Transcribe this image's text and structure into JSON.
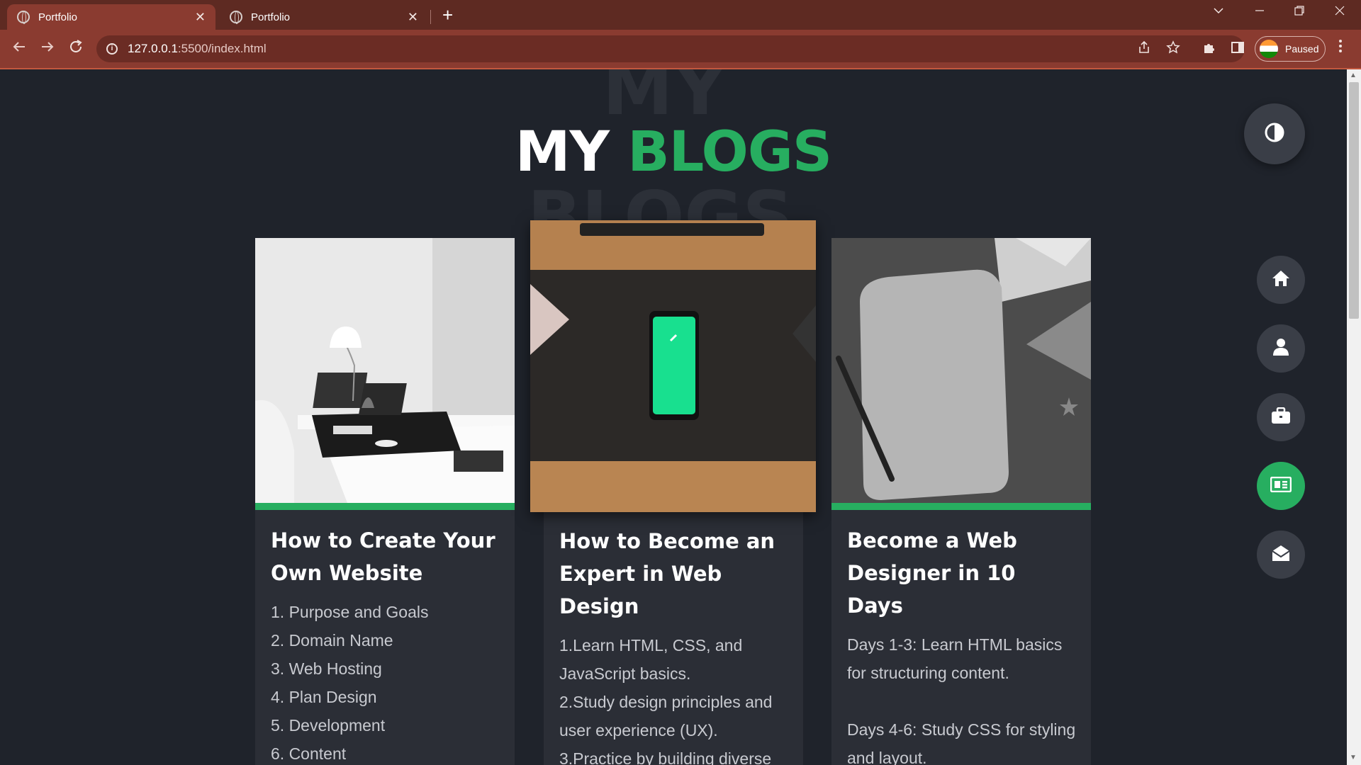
{
  "browser": {
    "tabs": [
      {
        "title": "Portfolio",
        "close": "✕"
      },
      {
        "title": "Portfolio",
        "close": "✕"
      }
    ],
    "new_tab": "+",
    "url_host": "127.0.0.1",
    "url_path": ":5500/index.html",
    "profile_label": "Paused"
  },
  "page": {
    "heading_first": "MY",
    "heading_accent": "BLOGS",
    "bg_word_1": "MY",
    "bg_word_2": "BLOGS",
    "accent_color": "#27ae60",
    "cards": [
      {
        "title": "How to Create Your Own Website",
        "items": [
          "1. Purpose and Goals",
          "2. Domain Name",
          "3. Web Hosting",
          "4. Plan Design",
          "5. Development",
          "6. Content"
        ]
      },
      {
        "title": "How to Become an Expert in Web Design",
        "items": [
          "1.Learn HTML, CSS, and JavaScript basics.",
          "2.Study design principles and user experience (UX).",
          "3.Practice by building diverse"
        ]
      },
      {
        "title": "Become a Web Designer in 10 Days",
        "items": [
          "Days 1-3: Learn HTML basics for structuring content.",
          "Days 4-6: Study CSS for styling and layout."
        ]
      }
    ],
    "side_nav": [
      {
        "icon": "home-icon"
      },
      {
        "icon": "user-icon"
      },
      {
        "icon": "briefcase-icon"
      },
      {
        "icon": "newspaper-icon",
        "active": true
      },
      {
        "icon": "envelope-open-icon"
      }
    ],
    "theme_toggle_icon": "contrast-icon"
  }
}
